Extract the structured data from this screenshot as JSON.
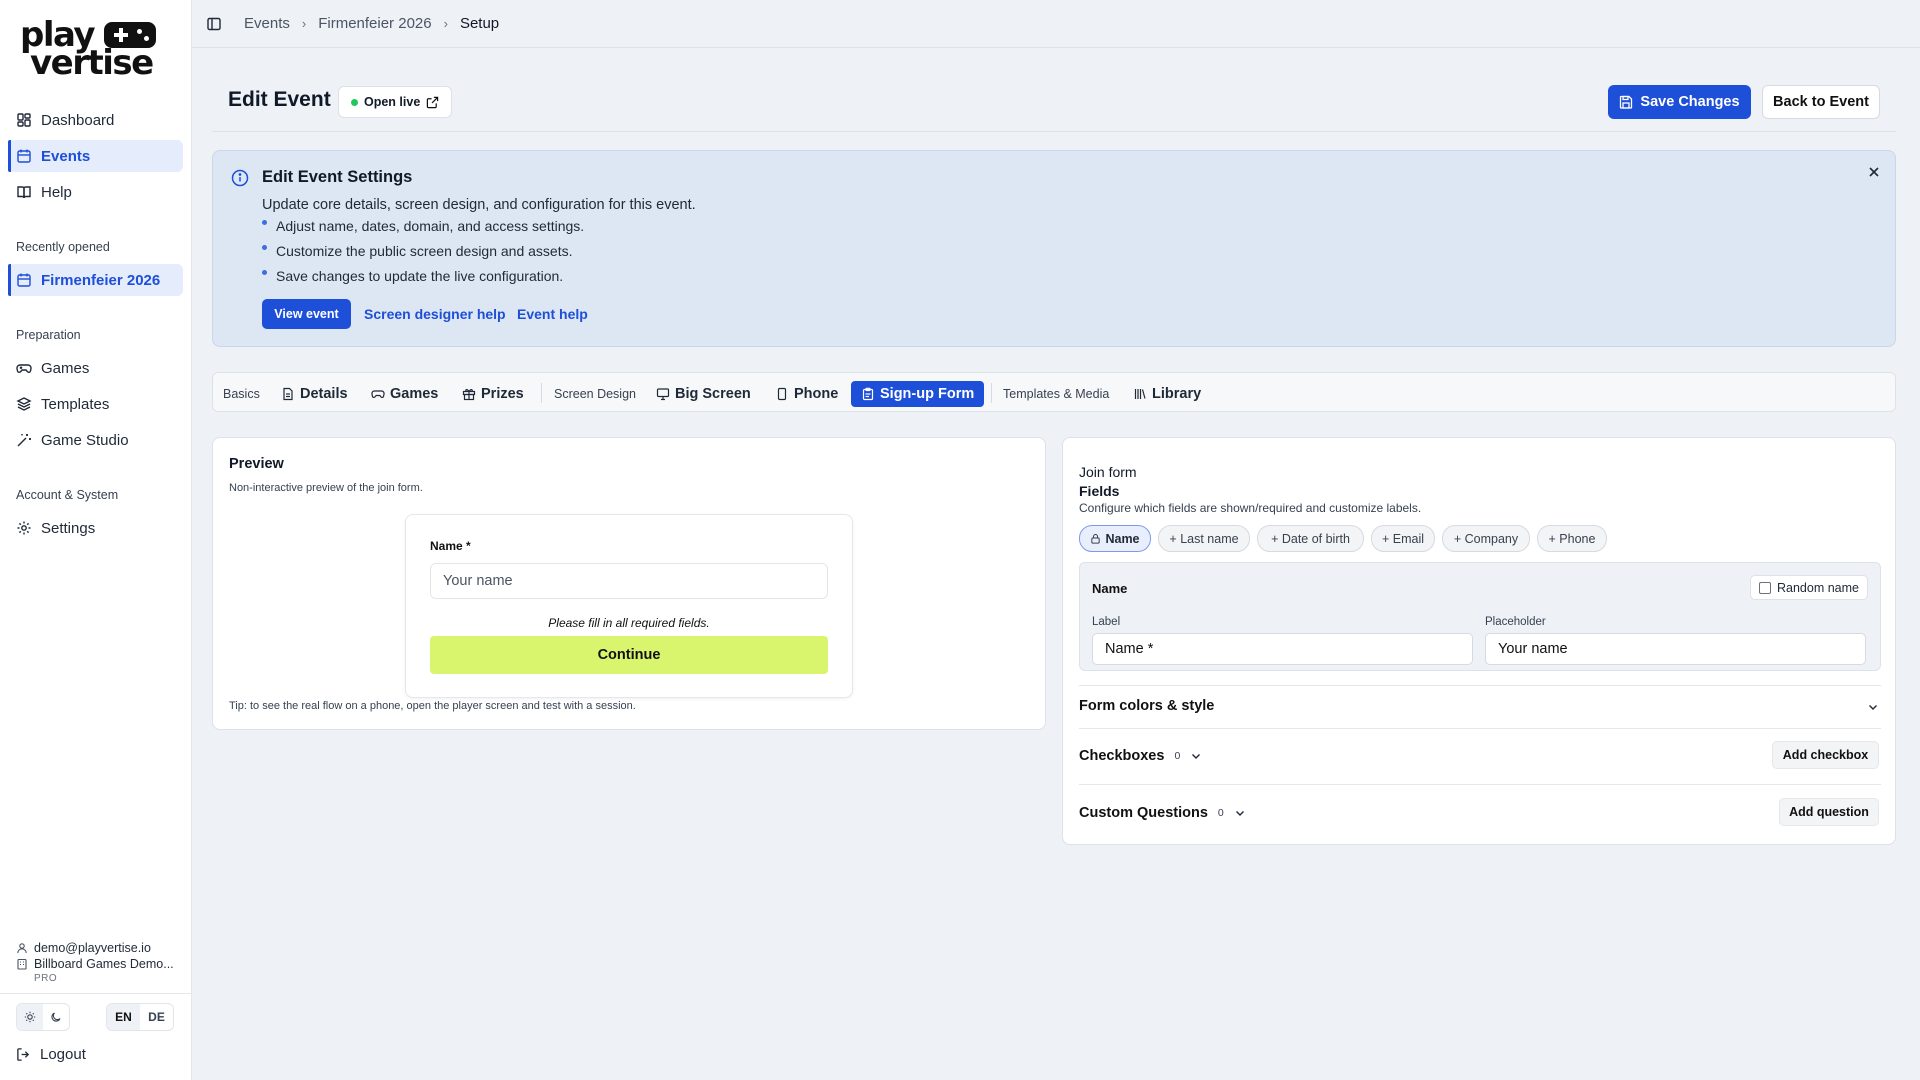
{
  "brand": {
    "logo_line1": "play",
    "logo_line2": "vertise",
    "accent": "#1d4fd8",
    "continue_color": "#d9f56e"
  },
  "sidebar": {
    "main": [
      {
        "label": "Dashboard",
        "icon": "dashboard-icon"
      },
      {
        "label": "Events",
        "icon": "calendar-icon",
        "active": true
      },
      {
        "label": "Help",
        "icon": "book-icon"
      }
    ],
    "recent_label": "Recently opened",
    "recent": [
      {
        "label": "Firmenfeier 2026",
        "icon": "calendar-icon",
        "active": true
      }
    ],
    "preparation_label": "Preparation",
    "preparation": [
      {
        "label": "Games",
        "icon": "gamepad-icon"
      },
      {
        "label": "Templates",
        "icon": "layers-icon"
      },
      {
        "label": "Game Studio",
        "icon": "magic-wand-icon"
      }
    ],
    "account_label": "Account & System",
    "account_items": [
      {
        "label": "Settings",
        "icon": "gear-icon"
      }
    ],
    "user_email": "demo@playvertise.io",
    "org": "Billboard Games Demo...",
    "plan": "PRO",
    "lang": [
      "EN",
      "DE"
    ],
    "logout": "Logout"
  },
  "breadcrumb": [
    "Events",
    "Firmenfeier 2026",
    "Setup"
  ],
  "header": {
    "title": "Edit Event",
    "open_live": "Open live",
    "save": "Save Changes",
    "back": "Back to Event"
  },
  "info": {
    "title": "Edit Event Settings",
    "description": "Update core details, screen design, and configuration for this event.",
    "bullets": [
      "Adjust name, dates, domain, and access settings.",
      "Customize the public screen design and assets.",
      "Save changes to update the live configuration."
    ],
    "view_event": "View event",
    "link1": "Screen designer help",
    "link2": "Event help"
  },
  "tabs": {
    "group1": "Basics",
    "details": "Details",
    "games": "Games",
    "prizes": "Prizes",
    "group2": "Screen Design",
    "big_screen": "Big Screen",
    "phone": "Phone",
    "signup": "Sign-up Form",
    "group3": "Templates & Media",
    "library": "Library"
  },
  "preview": {
    "title": "Preview",
    "subtitle": "Non-interactive preview of the join form.",
    "field_label": "Name *",
    "field_placeholder": "Your name",
    "note": "Please fill in all required fields.",
    "button": "Continue",
    "tip": "Tip: to see the real flow on a phone, open the player screen and test with a session."
  },
  "join_form": {
    "title": "Join form",
    "fields_title": "Fields",
    "fields_desc": "Configure which fields are shown/required and customize labels.",
    "chips": [
      "Name",
      "+ Last name",
      "+ Date of birth",
      "+ Email",
      "+ Company",
      "+ Phone"
    ],
    "panel_title": "Name",
    "random_name": "Random name",
    "label_caption": "Label",
    "label_value": "Name *",
    "placeholder_caption": "Placeholder",
    "placeholder_value": "Your name",
    "colors": "Form colors & style",
    "checkboxes": "Checkboxes",
    "checkboxes_count": "0",
    "add_checkbox": "Add checkbox",
    "custom_questions": "Custom Questions",
    "custom_count": "0",
    "add_question": "Add question"
  }
}
